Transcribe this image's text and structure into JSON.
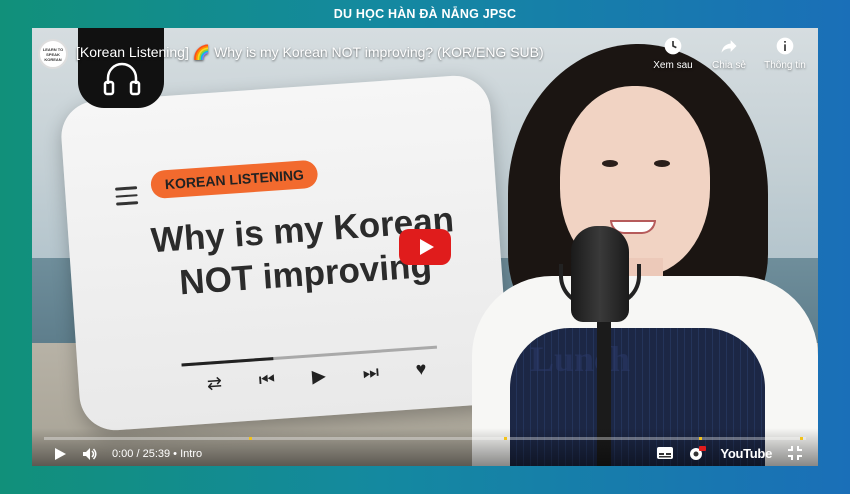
{
  "header": {
    "title": "DU HỌC HÀN ĐÀ NẴNG JPSC"
  },
  "video": {
    "title": "[Korean Listening] 🌈 Why is my Korean NOT improving? (KOR/ENG SUB)",
    "channel_logo_text": "LEARN TO SPEAK KOREAN"
  },
  "top_actions": [
    {
      "label": "Xem sau",
      "icon": "clock-icon"
    },
    {
      "label": "Chia sẻ",
      "icon": "share-icon"
    },
    {
      "label": "Thông tin",
      "icon": "info-icon"
    }
  ],
  "thumbnail": {
    "tag": "KOREAN LISTENING",
    "headline_line1": "Why is my Korean",
    "headline_line2": "NOT improving",
    "progress": 0.36,
    "shirt_text": "Lunch"
  },
  "controls": {
    "time_current": "0:00",
    "time_total": "25:39",
    "chapter": "Intro",
    "brand": "YouTube"
  },
  "colors": {
    "accent_orange": "#f26a2e",
    "youtube_red": "#e01c1c",
    "chapter_mark": "#f2c21a"
  }
}
